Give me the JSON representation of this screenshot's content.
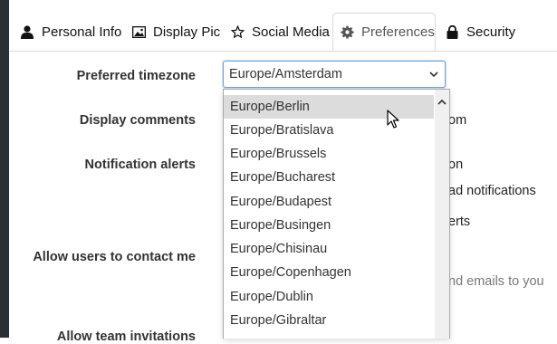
{
  "tabs": [
    {
      "label": "Personal Info",
      "icon": "user-icon"
    },
    {
      "label": "Display Pic",
      "icon": "image-icon"
    },
    {
      "label": "Social Media",
      "icon": "star-icon"
    },
    {
      "label": "Preferences",
      "icon": "gear-icon",
      "active": true
    },
    {
      "label": "Security",
      "icon": "lock-icon"
    }
  ],
  "form": {
    "timezone_label": "Preferred timezone",
    "timezone_value": "Europe/Amsterdam",
    "comments_label": "Display comments",
    "notifications_label": "Notification alerts",
    "contact_label": "Allow users to contact me",
    "team_label": "Allow team invitations"
  },
  "partial_text": {
    "om": "om",
    "on": "on",
    "ad_notifications": "ad notifications",
    "erts": "erts",
    "nd_emails": "nd emails to you"
  },
  "dropdown": {
    "options": [
      "Europe/Berlin",
      "Europe/Bratislava",
      "Europe/Brussels",
      "Europe/Bucharest",
      "Europe/Budapest",
      "Europe/Busingen",
      "Europe/Chisinau",
      "Europe/Copenhagen",
      "Europe/Dublin",
      "Europe/Gibraltar"
    ],
    "highlighted": "Europe/Berlin"
  },
  "colors": {
    "sidebar": "#2b3036",
    "focus_border": "#6aa4dc",
    "highlight": "#dcdcdc"
  }
}
